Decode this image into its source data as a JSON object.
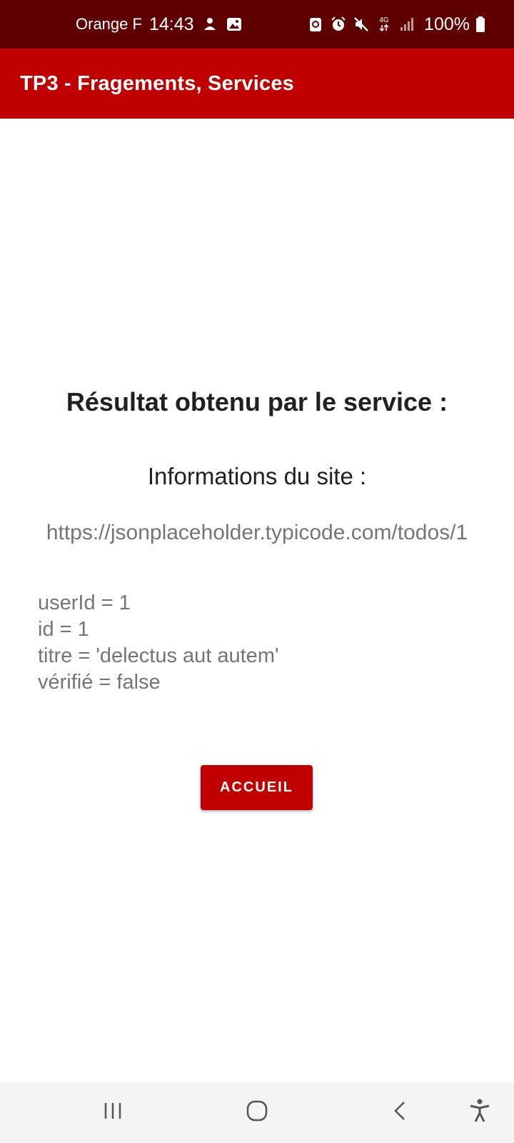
{
  "status_bar": {
    "carrier": "Orange F",
    "time": "14:43",
    "network_label": "4G",
    "battery": "100%"
  },
  "app_bar": {
    "title": "TP3 - Fragements, Services"
  },
  "main": {
    "heading": "Résultat obtenu par le service :",
    "subheading": "Informations du site :",
    "url": "https://jsonplaceholder.typicode.com/todos/1",
    "result_lines": [
      "userId = 1",
      "id = 1",
      "titre = 'delectus aut autem'",
      "vérifié = false"
    ],
    "home_button_label": "ACCUEIL"
  },
  "colors": {
    "status_bar": "#5e0000",
    "accent": "#c00000",
    "text_dark": "#202020",
    "text_gray": "#757575"
  },
  "nav_bar": {
    "icons": [
      "recents-icon",
      "home-icon",
      "back-icon",
      "accessibility-icon"
    ]
  }
}
